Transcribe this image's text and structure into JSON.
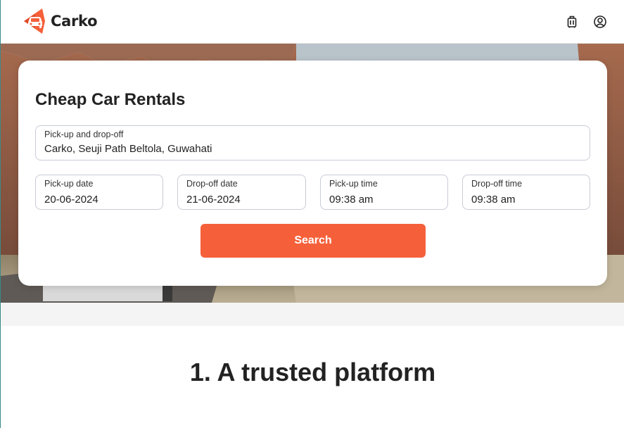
{
  "brand": {
    "name": "Carko",
    "accent": "#f5603a"
  },
  "header": {
    "icons": [
      "luggage-icon",
      "user-account-icon"
    ]
  },
  "search_card": {
    "title": "Cheap Car Rentals",
    "location": {
      "label": "Pick-up and drop-off",
      "value": "Carko, Seuji Path Beltola, Guwahati"
    },
    "pickup_date": {
      "label": "Pick-up date",
      "value": "20-06-2024"
    },
    "dropoff_date": {
      "label": "Drop-off date",
      "value": "21-06-2024"
    },
    "pickup_time": {
      "label": "Pick-up time",
      "value": "09:38 am"
    },
    "dropoff_time": {
      "label": "Drop-off time",
      "value": "09:38 am"
    },
    "search_label": "Search"
  },
  "section": {
    "title": "1. A trusted platform"
  }
}
